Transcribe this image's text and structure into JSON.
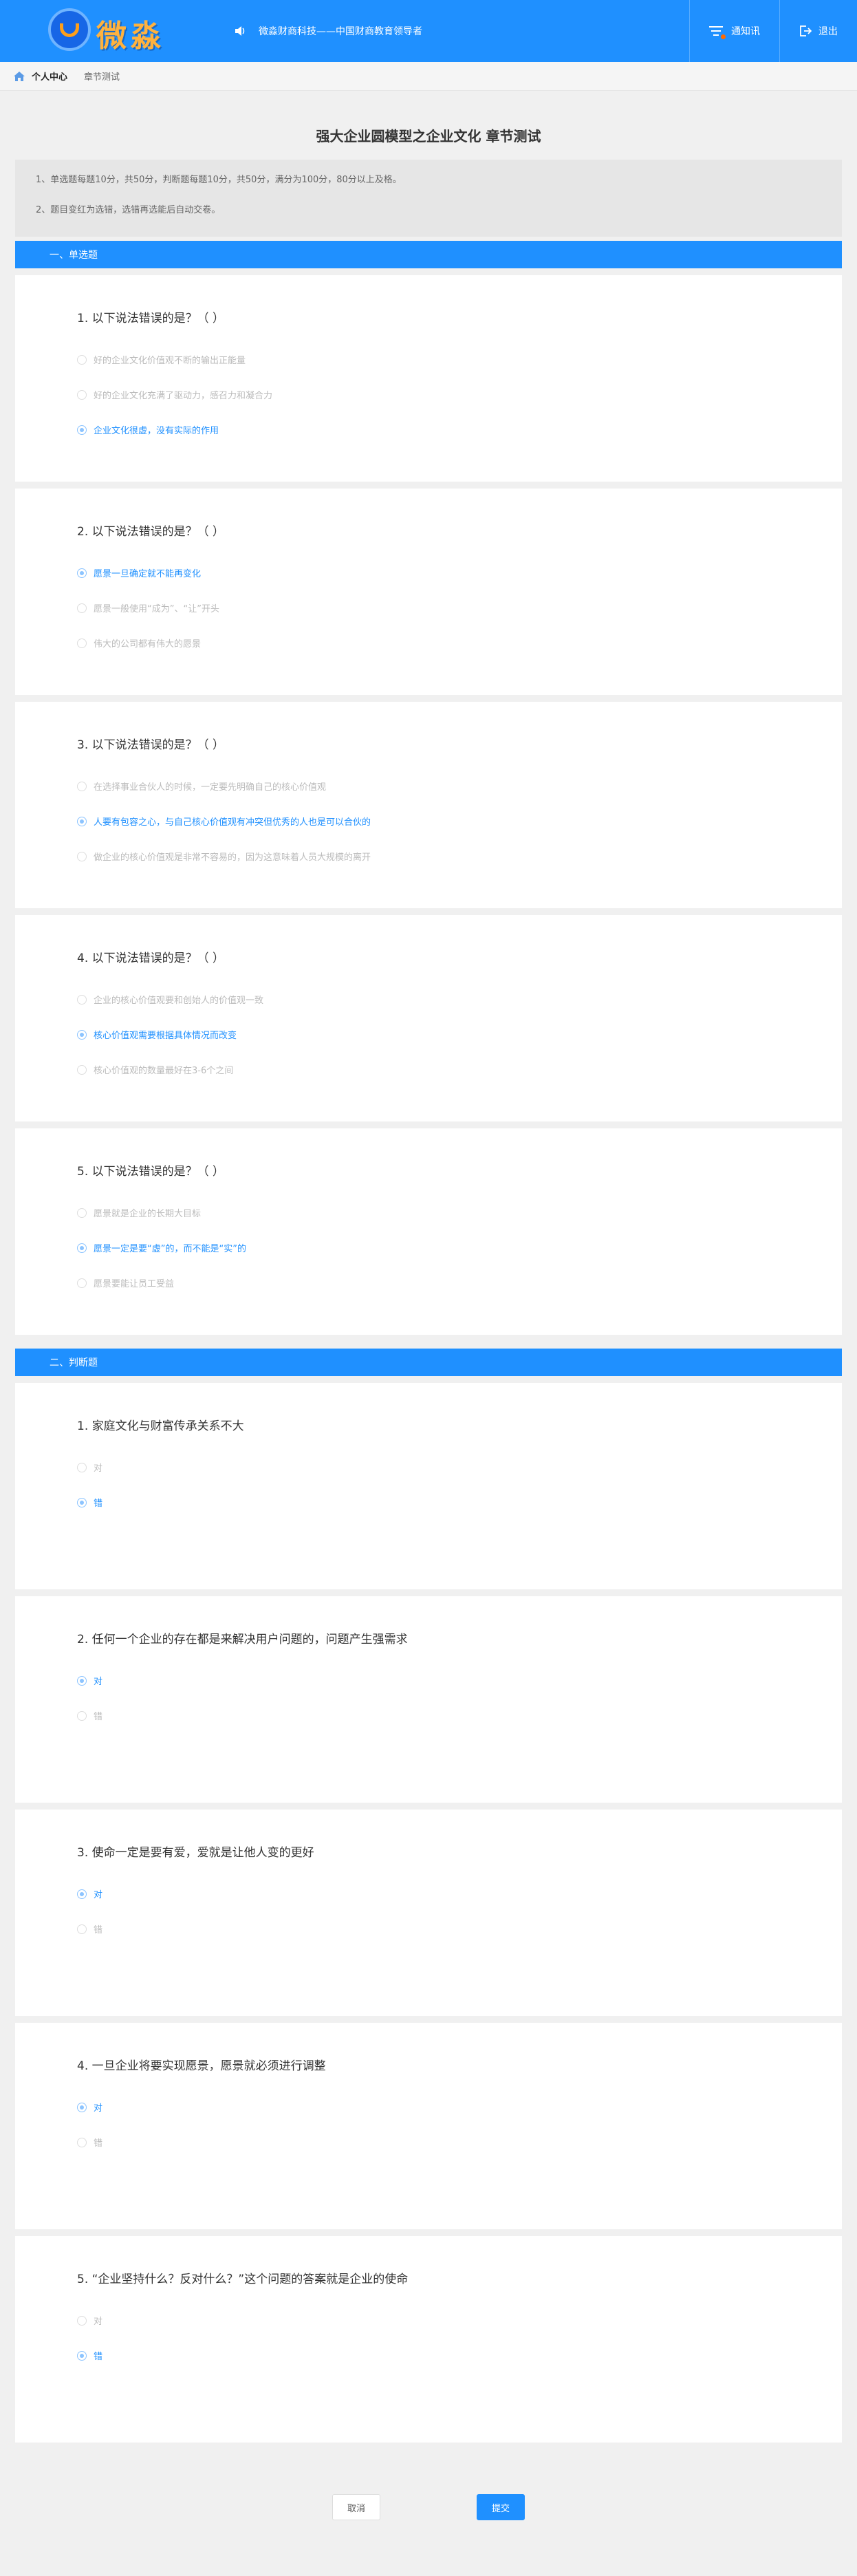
{
  "header": {
    "logo_text": "微淼",
    "slogan": "微淼财商科技——中国财商教育领导者",
    "message_label": "通知讯",
    "logout_label": "退出"
  },
  "breadcrumb": {
    "home": "个人中心",
    "current": "章节测试"
  },
  "title": "强大企业圆模型之企业文化 章节测试",
  "notice": [
    "1、单选题每题10分，共50分，判断题每题10分，共50分，满分为100分，80分以上及格。",
    "2、题目变红为选错，选错再选能后自动交卷。"
  ],
  "section1": {
    "title": "一、单选题"
  },
  "section2": {
    "title": "二、判断题"
  },
  "single_choice": [
    {
      "q": "1. 以下说法错误的是？（ ）",
      "options": [
        "好的企业文化价值观不断的输出正能量",
        "好的企业文化充满了驱动力，感召力和凝合力",
        "企业文化很虚，没有实际的作用"
      ],
      "selected": 2
    },
    {
      "q": "2. 以下说法错误的是？（ ）",
      "options": [
        "愿景一旦确定就不能再变化",
        "愿景一般使用“成为”、“让”开头",
        "伟大的公司都有伟大的愿景"
      ],
      "selected": 0
    },
    {
      "q": "3. 以下说法错误的是？（ ）",
      "options": [
        "在选择事业合伙人的时候，一定要先明确自己的核心价值观",
        "人要有包容之心，与自己核心价值观有冲突但优秀的人也是可以合伙的",
        "做企业的核心价值观是非常不容易的，因为这意味着人员大规模的离开"
      ],
      "selected": 1
    },
    {
      "q": "4. 以下说法错误的是？（ ）",
      "options": [
        "企业的核心价值观要和创始人的价值观一致",
        "核心价值观需要根据具体情况而改变",
        "核心价值观的数量最好在3-6个之间"
      ],
      "selected": 1
    },
    {
      "q": "5. 以下说法错误的是？（ ）",
      "options": [
        "愿景就是企业的长期大目标",
        "愿景一定是要“虚”的，而不能是“实”的",
        "愿景要能让员工受益"
      ],
      "selected": 1
    }
  ],
  "true_false": [
    {
      "q": "1. 家庭文化与财富传承关系不大",
      "options": [
        "对",
        "错"
      ],
      "selected": 1
    },
    {
      "q": "2. 任何一个企业的存在都是来解决用户问题的，问题产生强需求",
      "options": [
        "对",
        "错"
      ],
      "selected": 0
    },
    {
      "q": "3. 使命一定是要有爱，爱就是让他人变的更好",
      "options": [
        "对",
        "错"
      ],
      "selected": 0
    },
    {
      "q": "4. 一旦企业将要实现愿景，愿景就必须进行调整",
      "options": [
        "对",
        "错"
      ],
      "selected": 0
    },
    {
      "q": "5. “企业坚持什么？反对什么？”这个问题的答案就是企业的使命",
      "options": [
        "对",
        "错"
      ],
      "selected": 1
    }
  ],
  "buttons": {
    "cancel": "取消",
    "submit": "提交"
  },
  "colors": {
    "primary": "#1f90ff",
    "logo_orange": "#ffb23e",
    "background": "#f0f0f0"
  }
}
